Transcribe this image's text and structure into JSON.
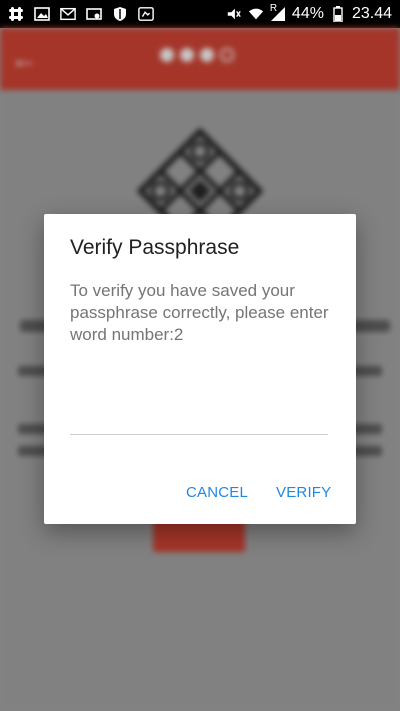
{
  "status_bar": {
    "battery_percent": "44%",
    "time": "23.44",
    "network_label": "R",
    "left_icons": [
      "slack-icon",
      "image-icon",
      "gmail-icon",
      "cast-icon",
      "shield-icon",
      "screenshot-icon"
    ],
    "right_icons": [
      "mute-icon",
      "wifi-icon",
      "signal-icon",
      "battery-icon"
    ]
  },
  "app": {
    "steps": [
      true,
      true,
      true,
      false
    ],
    "accent_color": "#b33a2d"
  },
  "dialog": {
    "title": "Verify Passphrase",
    "message": "To verify you have saved your passphrase correctly, please enter word number:2",
    "input_value": "",
    "input_placeholder": "",
    "cancel_label": "CANCEL",
    "verify_label": "VERIFY",
    "button_color": "#1e88e5"
  }
}
